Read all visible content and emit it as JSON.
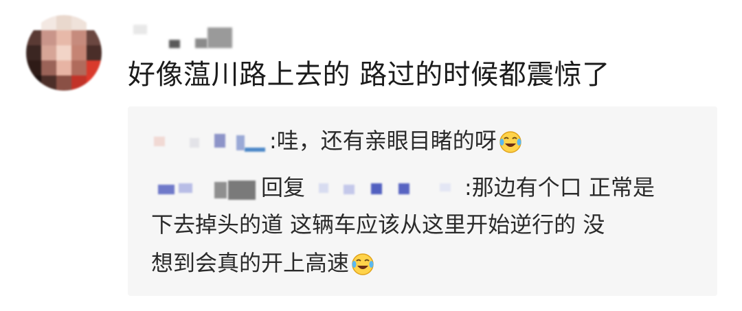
{
  "comment": {
    "text": "好像蕰川路上去的 路过的时候都震惊了"
  },
  "replies": [
    {
      "separator": ":",
      "text": "哇，还有亲眼目睹的呀",
      "emoji": "laughing-crying-face"
    },
    {
      "reply_word": "回复",
      "separator": ":",
      "text_line1": "那边有个口 正常是",
      "text_line2": "下去掉头的道 这辆车应该从这里开始逆行的 没",
      "text_line3": "想到会真的开上高速",
      "emoji": "laughing-crying-face"
    }
  ],
  "colors": {
    "reply_background": "#f6f6f6",
    "text": "#1f1f1f",
    "name_blur": "#6e78c8"
  }
}
